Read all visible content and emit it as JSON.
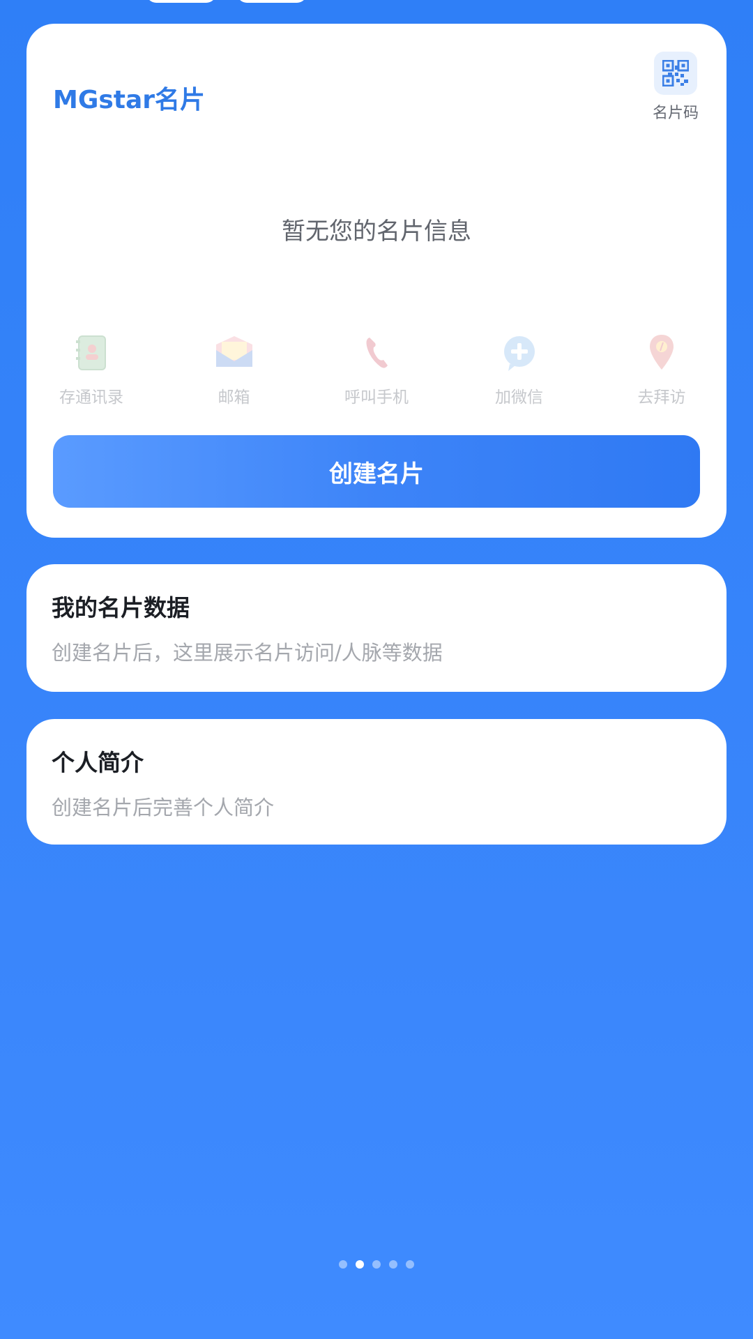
{
  "brand": {
    "title": "MGstar名片",
    "color": "#2f7ae6"
  },
  "qr": {
    "icon": "qr-code-icon",
    "label": "名片码"
  },
  "empty_message": "暂无您的名片信息",
  "actions": [
    {
      "icon": "address-book-icon",
      "label": "存通讯录"
    },
    {
      "icon": "envelope-icon",
      "label": "邮箱"
    },
    {
      "icon": "phone-icon",
      "label": "呼叫手机"
    },
    {
      "icon": "wechat-add-icon",
      "label": "加微信"
    },
    {
      "icon": "location-pin-icon",
      "label": "去拜访"
    }
  ],
  "create_button": {
    "label": "创建名片"
  },
  "card_data": {
    "title": "我的名片数据",
    "description": "创建名片后，这里展示名片访问/人脉等数据"
  },
  "intro": {
    "title": "个人简介",
    "description": "创建名片后完善个人简介"
  },
  "pager": {
    "total": 5,
    "active": 2
  },
  "colors": {
    "background": "#3a86fb",
    "accent": "#2f7ae6",
    "card": "#ffffff"
  }
}
